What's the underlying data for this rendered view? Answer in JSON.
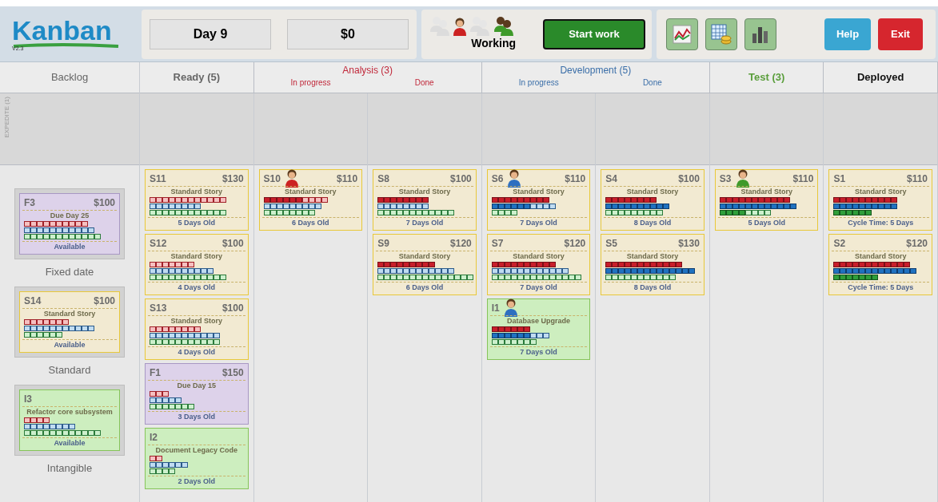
{
  "logo": {
    "name": "Kanban",
    "version": "V2.3"
  },
  "day": "Day 9",
  "money": "$0",
  "team": {
    "members": [
      {
        "kind": "pair",
        "color": "#dcdcdc"
      },
      {
        "kind": "single",
        "color": "#cc2222"
      },
      {
        "kind": "pair",
        "color": "#dcdcdc"
      },
      {
        "kind": "pair",
        "color": "#3e9a2a"
      }
    ],
    "status": "Working"
  },
  "start_button": "Start work",
  "help_button": "Help",
  "exit_button": "Exit",
  "expedite": "EXPEDITE (1)",
  "columns": [
    {
      "title": "Backlog",
      "color": "#666666",
      "classes": [
        {
          "label": "Fixed date",
          "card": {
            "kind": "fixed",
            "id": "F3",
            "value": "$100",
            "title": "Due Day 25",
            "footer": "Available",
            "work": [
              {
                "kind": "analysis",
                "cells": [
                  false,
                  false,
                  false,
                  false,
                  false,
                  false,
                  false,
                  false,
                  false,
                  false
                ]
              },
              {
                "kind": "development",
                "cells": [
                  false,
                  false,
                  false,
                  false,
                  false,
                  false,
                  false,
                  false,
                  false,
                  false,
                  false
                ]
              },
              {
                "kind": "test",
                "cells": [
                  false,
                  false,
                  false,
                  false,
                  false,
                  false,
                  false,
                  false,
                  false,
                  false,
                  false,
                  false
                ]
              }
            ]
          }
        },
        {
          "label": "Standard",
          "card": {
            "kind": "standard",
            "id": "S14",
            "value": "$100",
            "title": "Standard Story",
            "footer": "Available",
            "work": [
              {
                "kind": "analysis",
                "cells": [
                  false,
                  false,
                  false,
                  false,
                  false,
                  false,
                  false
                ]
              },
              {
                "kind": "development",
                "cells": [
                  false,
                  false,
                  false,
                  false,
                  false,
                  false,
                  false,
                  false,
                  false,
                  false,
                  false
                ]
              },
              {
                "kind": "test",
                "cells": [
                  false,
                  false,
                  false,
                  false,
                  false,
                  false
                ]
              }
            ]
          }
        },
        {
          "label": "Intangible",
          "card": {
            "kind": "intangible",
            "id": "I3",
            "title": "Refactor core subsystem",
            "footer": "Available",
            "work": [
              {
                "kind": "analysis",
                "cells": [
                  false,
                  false,
                  false,
                  false
                ]
              },
              {
                "kind": "development",
                "cells": [
                  false,
                  false,
                  false,
                  false,
                  false,
                  false,
                  false,
                  false
                ]
              },
              {
                "kind": "test",
                "cells": [
                  false,
                  false,
                  false,
                  false,
                  false,
                  false,
                  false,
                  false,
                  false,
                  false,
                  false,
                  false
                ]
              }
            ]
          }
        }
      ]
    },
    {
      "title": "Ready (5)",
      "color": "#666666",
      "cards": [
        {
          "kind": "standard",
          "id": "S11",
          "value": "$130",
          "title": "Standard Story",
          "footer": "5 Days Old",
          "work": [
            {
              "kind": "analysis",
              "cells": [
                false,
                false,
                false,
                false,
                false,
                false,
                false,
                false,
                false,
                false,
                false,
                false
              ]
            },
            {
              "kind": "development",
              "cells": [
                false,
                false,
                false,
                false,
                false,
                false,
                false,
                false
              ]
            },
            {
              "kind": "test",
              "cells": [
                false,
                false,
                false,
                false,
                false,
                false,
                false,
                false,
                false,
                false,
                false,
                false
              ]
            }
          ]
        },
        {
          "kind": "standard",
          "id": "S12",
          "value": "$100",
          "title": "Standard Story",
          "footer": "4 Days Old",
          "work": [
            {
              "kind": "analysis",
              "cells": [
                false,
                false,
                false,
                false,
                false,
                false,
                false
              ]
            },
            {
              "kind": "development",
              "cells": [
                false,
                false,
                false,
                false,
                false,
                false,
                false,
                false,
                false,
                false
              ]
            },
            {
              "kind": "test",
              "cells": [
                false,
                false,
                false,
                false,
                false,
                false,
                false,
                false,
                false,
                false,
                false,
                false
              ]
            }
          ]
        },
        {
          "kind": "standard",
          "id": "S13",
          "value": "$100",
          "title": "Standard Story",
          "footer": "4 Days Old",
          "work": [
            {
              "kind": "analysis",
              "cells": [
                false,
                false,
                false,
                false,
                false,
                false,
                false,
                false
              ]
            },
            {
              "kind": "development",
              "cells": [
                false,
                false,
                false,
                false,
                false,
                false,
                false,
                false,
                false,
                false,
                false
              ]
            },
            {
              "kind": "test",
              "cells": [
                false,
                false,
                false,
                false,
                false,
                false,
                false,
                false,
                false,
                false,
                false
              ]
            }
          ]
        },
        {
          "kind": "fixed",
          "id": "F1",
          "value": "$150",
          "title": "Due Day 15",
          "footer": "3 Days Old",
          "work": [
            {
              "kind": "analysis",
              "cells": [
                false,
                false,
                false
              ]
            },
            {
              "kind": "development",
              "cells": [
                false,
                false,
                false,
                false,
                false
              ]
            },
            {
              "kind": "test",
              "cells": [
                false,
                false,
                false,
                false,
                false,
                false,
                false
              ]
            }
          ]
        },
        {
          "kind": "intangible",
          "id": "I2",
          "title": "Document Legacy Code",
          "footer": "2 Days Old",
          "work": [
            {
              "kind": "analysis",
              "cells": [
                false,
                false
              ]
            },
            {
              "kind": "development",
              "cells": [
                false,
                false,
                false,
                false,
                false,
                false
              ]
            },
            {
              "kind": "test",
              "cells": [
                false,
                false,
                false,
                false
              ]
            }
          ]
        }
      ]
    },
    {
      "title": "Analysis (3)",
      "color": "#c0283a",
      "subcolumns": [
        {
          "title": "In progress",
          "cards": [
            {
              "kind": "standard",
              "id": "S10",
              "value": "$110",
              "worker": {
                "color": "#cc2222"
              },
              "title": "Standard Story",
              "footer": "6 Days Old",
              "work": [
                {
                  "kind": "analysis",
                  "cells": [
                    true,
                    true,
                    true,
                    true,
                    true,
                    true,
                    false,
                    false,
                    false,
                    false
                  ]
                },
                {
                  "kind": "development",
                  "cells": [
                    false,
                    false,
                    false,
                    false,
                    false,
                    false,
                    false,
                    false,
                    false
                  ]
                },
                {
                  "kind": "test",
                  "cells": [
                    false,
                    false,
                    false,
                    false,
                    false,
                    false,
                    false,
                    false
                  ]
                }
              ]
            }
          ]
        },
        {
          "title": "Done",
          "cards": [
            {
              "kind": "standard",
              "id": "S8",
              "value": "$100",
              "title": "Standard Story",
              "footer": "7 Days Old",
              "work": [
                {
                  "kind": "analysis",
                  "cells": [
                    true,
                    true,
                    true,
                    true,
                    true,
                    true,
                    true,
                    true
                  ]
                },
                {
                  "kind": "development",
                  "cells": [
                    false,
                    false,
                    false,
                    false,
                    false,
                    false,
                    false,
                    false
                  ]
                },
                {
                  "kind": "test",
                  "cells": [
                    false,
                    false,
                    false,
                    false,
                    false,
                    false,
                    false,
                    false,
                    false,
                    false,
                    false,
                    false
                  ]
                }
              ]
            },
            {
              "kind": "standard",
              "id": "S9",
              "value": "$120",
              "title": "Standard Story",
              "footer": "6 Days Old",
              "work": [
                {
                  "kind": "analysis",
                  "cells": [
                    true,
                    true,
                    true,
                    true,
                    true,
                    true,
                    true,
                    true,
                    true
                  ]
                },
                {
                  "kind": "development",
                  "cells": [
                    false,
                    false,
                    false,
                    false,
                    false,
                    false,
                    false,
                    false,
                    false,
                    false,
                    false,
                    false
                  ]
                },
                {
                  "kind": "test",
                  "cells": [
                    false,
                    false,
                    false,
                    false,
                    false,
                    false,
                    false,
                    false,
                    false,
                    false,
                    false,
                    false,
                    false,
                    false,
                    false
                  ]
                }
              ]
            }
          ]
        }
      ]
    },
    {
      "title": "Development (5)",
      "color": "#3a6ea8",
      "subcolumns": [
        {
          "title": "In progress",
          "cards": [
            {
              "kind": "standard",
              "id": "S6",
              "value": "$110",
              "worker": {
                "color": "#2e6fc0"
              },
              "title": "Standard Story",
              "footer": "7 Days Old",
              "work": [
                {
                  "kind": "analysis",
                  "cells": [
                    true,
                    true,
                    true,
                    true,
                    true,
                    true,
                    true,
                    true,
                    true
                  ]
                },
                {
                  "kind": "development",
                  "cells": [
                    true,
                    true,
                    true,
                    true,
                    true,
                    true,
                    false,
                    false,
                    false,
                    false
                  ]
                },
                {
                  "kind": "test",
                  "cells": [
                    false,
                    false,
                    false,
                    false
                  ]
                }
              ]
            },
            {
              "kind": "standard",
              "id": "S7",
              "value": "$120",
              "title": "Standard Story",
              "footer": "7 Days Old",
              "work": [
                {
                  "kind": "analysis",
                  "cells": [
                    true,
                    true,
                    true,
                    true,
                    true,
                    true,
                    true,
                    true,
                    true,
                    true
                  ]
                },
                {
                  "kind": "development",
                  "cells": [
                    false,
                    false,
                    false,
                    false,
                    false,
                    false,
                    false,
                    false,
                    false,
                    false,
                    false,
                    false
                  ]
                },
                {
                  "kind": "test",
                  "cells": [
                    false,
                    false,
                    false,
                    false,
                    false,
                    false,
                    false,
                    false,
                    false,
                    false,
                    false,
                    false,
                    false,
                    false
                  ]
                }
              ]
            },
            {
              "kind": "intangible",
              "id": "I1",
              "worker": {
                "color": "#2e6fc0"
              },
              "title": "Database Upgrade",
              "footer": "7 Days Old",
              "work": [
                {
                  "kind": "analysis",
                  "cells": [
                    true,
                    true,
                    true,
                    true,
                    true,
                    true
                  ]
                },
                {
                  "kind": "development",
                  "cells": [
                    true,
                    true,
                    true,
                    true,
                    true,
                    true,
                    false,
                    false,
                    false
                  ]
                },
                {
                  "kind": "test",
                  "cells": [
                    false,
                    false,
                    false,
                    false,
                    false,
                    false,
                    false
                  ]
                }
              ]
            }
          ]
        },
        {
          "title": "Done",
          "cards": [
            {
              "kind": "standard",
              "id": "S4",
              "value": "$100",
              "title": "Standard Story",
              "footer": "8 Days Old",
              "work": [
                {
                  "kind": "analysis",
                  "cells": [
                    true,
                    true,
                    true,
                    true,
                    true,
                    true,
                    true,
                    true
                  ]
                },
                {
                  "kind": "development",
                  "cells": [
                    true,
                    true,
                    true,
                    true,
                    true,
                    true,
                    true,
                    true,
                    true,
                    true
                  ]
                },
                {
                  "kind": "test",
                  "cells": [
                    false,
                    false,
                    false,
                    false,
                    false,
                    false,
                    false,
                    false,
                    false
                  ]
                }
              ]
            },
            {
              "kind": "standard",
              "id": "S5",
              "value": "$130",
              "title": "Standard Story",
              "footer": "8 Days Old",
              "work": [
                {
                  "kind": "analysis",
                  "cells": [
                    true,
                    true,
                    true,
                    true,
                    true,
                    true,
                    true,
                    true,
                    true,
                    true,
                    true,
                    true
                  ]
                },
                {
                  "kind": "development",
                  "cells": [
                    true,
                    true,
                    true,
                    true,
                    true,
                    true,
                    true,
                    true,
                    true,
                    true,
                    true,
                    true,
                    true,
                    true
                  ]
                },
                {
                  "kind": "test",
                  "cells": [
                    false,
                    false,
                    false,
                    false,
                    false,
                    false,
                    false,
                    false,
                    false,
                    false,
                    false
                  ]
                }
              ]
            }
          ]
        }
      ]
    },
    {
      "title": "Test (3)",
      "color": "#5a9e3c",
      "cards": [
        {
          "kind": "standard",
          "id": "S3",
          "value": "$110",
          "worker": {
            "color": "#3e9a2a"
          },
          "title": "Standard Story",
          "footer": "5 Days Old",
          "work": [
            {
              "kind": "analysis",
              "cells": [
                true,
                true,
                true,
                true,
                true,
                true,
                true,
                true,
                true,
                true,
                true
              ]
            },
            {
              "kind": "development",
              "cells": [
                true,
                true,
                true,
                true,
                true,
                true,
                true,
                true,
                true,
                true,
                true,
                true
              ]
            },
            {
              "kind": "test",
              "cells": [
                true,
                true,
                true,
                true,
                false,
                false,
                false,
                false
              ]
            }
          ]
        }
      ]
    },
    {
      "title": "Deployed",
      "color": "#111111",
      "cards": [
        {
          "kind": "standard",
          "id": "S1",
          "value": "$110",
          "title": "Standard Story",
          "footer": "Cycle Time: 5 Days",
          "work": [
            {
              "kind": "analysis",
              "cells": [
                true,
                true,
                true,
                true,
                true,
                true,
                true,
                true,
                true,
                true
              ]
            },
            {
              "kind": "development",
              "cells": [
                true,
                true,
                true,
                true,
                true,
                true,
                true,
                true,
                true,
                true
              ]
            },
            {
              "kind": "test",
              "cells": [
                true,
                true,
                true,
                true,
                true,
                true
              ]
            }
          ]
        },
        {
          "kind": "standard",
          "id": "S2",
          "value": "$120",
          "title": "Standard Story",
          "footer": "Cycle Time: 5 Days",
          "work": [
            {
              "kind": "analysis",
              "cells": [
                true,
                true,
                true,
                true,
                true,
                true,
                true,
                true,
                true,
                true,
                true,
                true
              ]
            },
            {
              "kind": "development",
              "cells": [
                true,
                true,
                true,
                true,
                true,
                true,
                true,
                true,
                true,
                true,
                true,
                true,
                true
              ]
            },
            {
              "kind": "test",
              "cells": [
                true,
                true,
                true,
                true,
                true,
                true,
                true
              ]
            }
          ]
        }
      ]
    }
  ]
}
